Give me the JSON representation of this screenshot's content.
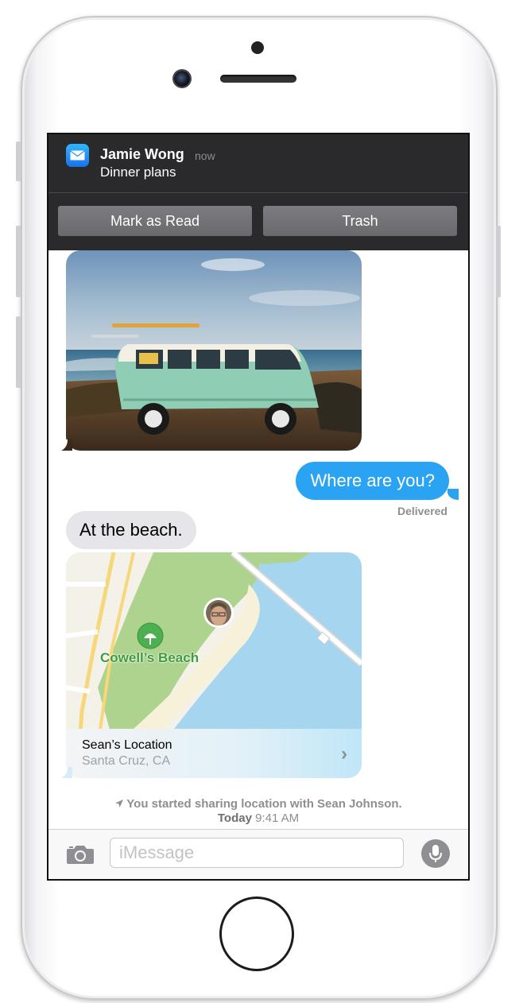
{
  "notification": {
    "app_icon": "mail-icon",
    "sender": "Jamie Wong",
    "time": "now",
    "message": "Dinner plans",
    "actions": [
      "Mark as Read",
      "Trash"
    ]
  },
  "conversation": {
    "outgoing_message": "Where are you?",
    "delivery_status": "Delivered",
    "incoming_message": "At the beach.",
    "map": {
      "place_label": "Cowell’s Beach",
      "location_title": "Sean’s Location",
      "location_subtitle": "Santa Cruz, CA"
    },
    "system_note": "You started sharing location with Sean Johnson.",
    "timestamp_day": "Today",
    "timestamp_time": "9:41 AM"
  },
  "input_bar": {
    "placeholder": "iMessage"
  },
  "colors": {
    "bubble_outgoing": "#2aa3f3",
    "bubble_incoming": "#e5e5ea",
    "notification_bg": "#2a2a2c"
  }
}
